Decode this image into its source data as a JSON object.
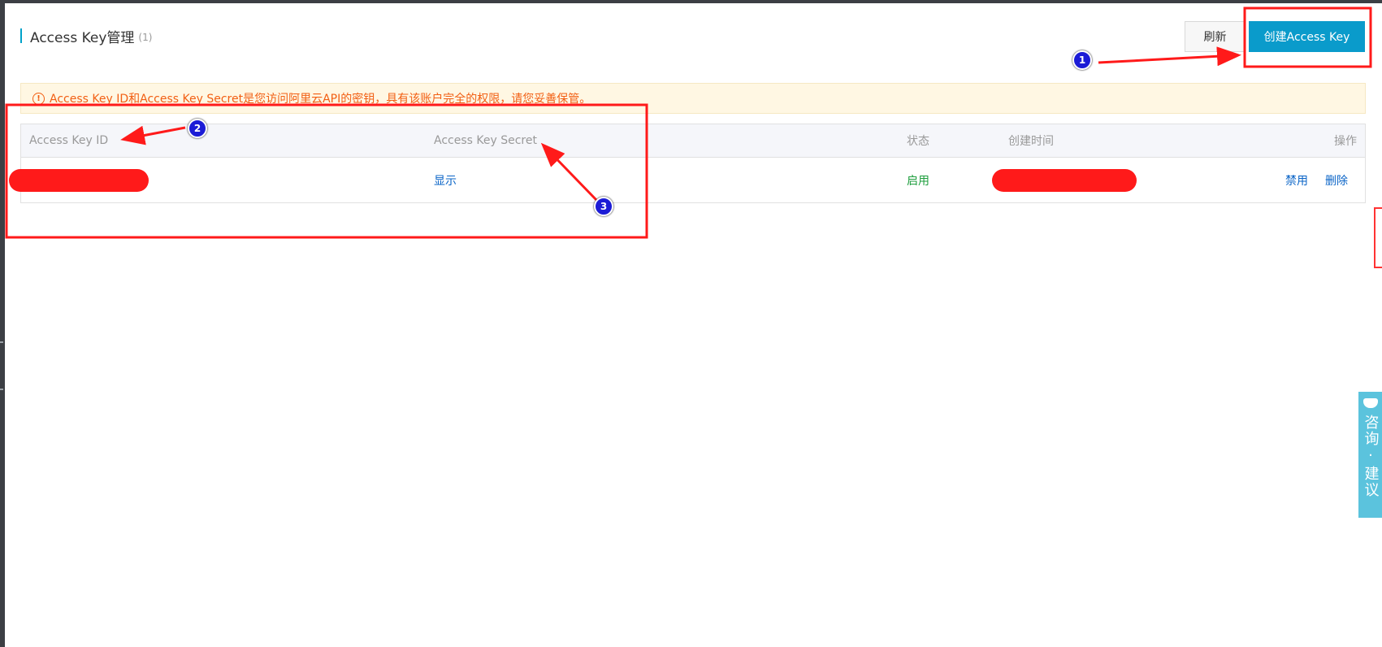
{
  "header": {
    "title": "Access Key管理",
    "count": "(1)"
  },
  "toolbar": {
    "refresh_label": "刷新",
    "create_label": "创建Access Key"
  },
  "alert": {
    "icon": "!",
    "text": "Access Key ID和Access Key Secret是您访问阿里云API的密钥，具有该账户完全的权限，请您妥善保管。"
  },
  "table": {
    "columns": [
      "Access Key ID",
      "Access Key Secret",
      "状态",
      "创建时间",
      "操作"
    ],
    "rows": [
      {
        "access_key_id": "",
        "secret_action": "显示",
        "status": "启用",
        "created_at": "",
        "actions": [
          "禁用",
          "删除"
        ]
      }
    ]
  },
  "feedback": {
    "label": "咨询·建议"
  },
  "annotations": [
    "1",
    "2",
    "3"
  ],
  "colors": {
    "primary": "#0a9bcb",
    "alert_text": "#f25f13",
    "status_enabled": "#1e9e3d",
    "link": "#0a64c7",
    "annotation": "#ff1a1a"
  }
}
